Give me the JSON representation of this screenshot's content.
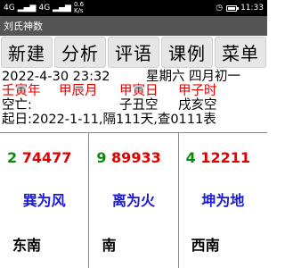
{
  "statusbar": {
    "left_net": "4G",
    "left_sig": "4G",
    "speed_top": "0.6",
    "speed_unit": "K/s",
    "time": "11:33"
  },
  "app": {
    "title": "刘氏神数"
  },
  "toolbar": [
    {
      "label": "新建"
    },
    {
      "label": "分析"
    },
    {
      "label": "评语"
    },
    {
      "label": "课例"
    },
    {
      "label": "菜单"
    }
  ],
  "info": {
    "datetime": "2022-4-30 23:32",
    "weekday": "星期六",
    "lunar": "四月初一",
    "ganzhi": [
      "壬寅年",
      "甲辰月",
      "甲寅日",
      "甲子时"
    ],
    "kongwang_label": "空亡:",
    "kongwang": [
      "子丑空",
      "戌亥空"
    ],
    "start_line": "起日:2022-1-11,隔111天,查0111表"
  },
  "cards": [
    {
      "lead": "2",
      "number": "74477",
      "gua": "巽为风",
      "direction": "东南"
    },
    {
      "lead": "9",
      "number": "89933",
      "gua": "离为火",
      "direction": "南"
    },
    {
      "lead": "4",
      "number": "12211",
      "gua": "坤为地",
      "direction": "西南"
    }
  ]
}
